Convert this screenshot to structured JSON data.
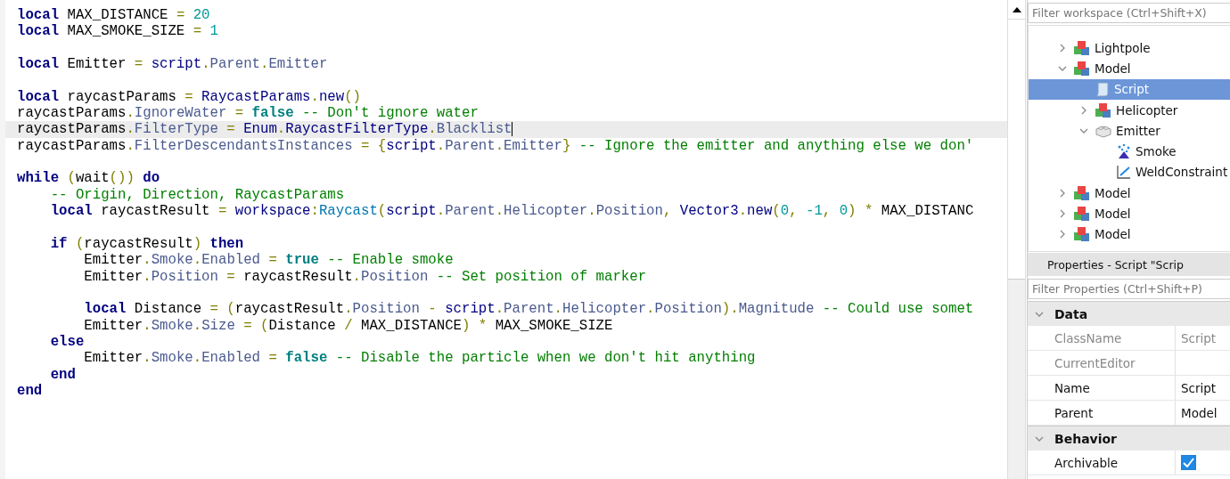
{
  "editor": {
    "lines": [
      {
        "kind": "code",
        "tokens": [
          {
            "kind": "kw",
            "text": "local"
          },
          {
            "kind": "p",
            "text": " MAX_DISTANCE"
          },
          {
            "kind": "op",
            "text": " ="
          },
          {
            "kind": "num",
            "text": " 20"
          }
        ]
      },
      {
        "kind": "code",
        "tokens": [
          {
            "kind": "kw",
            "text": "local"
          },
          {
            "kind": "p",
            "text": " MAX_SMOKE_SIZE"
          },
          {
            "kind": "op",
            "text": " ="
          },
          {
            "kind": "num",
            "text": " 1"
          }
        ]
      },
      {
        "kind": "blank"
      },
      {
        "kind": "code",
        "tokens": [
          {
            "kind": "kw",
            "text": "local"
          },
          {
            "kind": "p",
            "text": " Emitter"
          },
          {
            "kind": "op",
            "text": " ="
          },
          {
            "kind": "g",
            "text": " script"
          },
          {
            "kind": "op",
            "text": "."
          },
          {
            "kind": "pr",
            "text": "Parent"
          },
          {
            "kind": "op",
            "text": "."
          },
          {
            "kind": "pr",
            "text": "Emitter"
          }
        ]
      },
      {
        "kind": "blank"
      },
      {
        "kind": "code",
        "tokens": [
          {
            "kind": "kw",
            "text": "local"
          },
          {
            "kind": "p",
            "text": " raycastParams"
          },
          {
            "kind": "op",
            "text": " ="
          },
          {
            "kind": "g",
            "text": " RaycastParams"
          },
          {
            "kind": "op",
            "text": "."
          },
          {
            "kind": "g",
            "text": "new"
          },
          {
            "kind": "op",
            "text": "()"
          }
        ]
      },
      {
        "kind": "code",
        "tokens": [
          {
            "kind": "p",
            "text": "raycastParams"
          },
          {
            "kind": "op",
            "text": "."
          },
          {
            "kind": "pr",
            "text": "IgnoreWater"
          },
          {
            "kind": "op",
            "text": " ="
          },
          {
            "kind": "lit",
            "text": " false"
          },
          {
            "kind": "c",
            "text": " -- Don't ignore water"
          }
        ]
      },
      {
        "kind": "code",
        "current": true,
        "tokens": [
          {
            "kind": "p",
            "text": "raycastParams"
          },
          {
            "kind": "op",
            "text": "."
          },
          {
            "kind": "pr",
            "text": "FilterType"
          },
          {
            "kind": "op",
            "text": " ="
          },
          {
            "kind": "g",
            "text": " Enum"
          },
          {
            "kind": "op",
            "text": "."
          },
          {
            "kind": "g",
            "text": "RaycastFilterType"
          },
          {
            "kind": "op",
            "text": "."
          },
          {
            "kind": "pr",
            "text": "Blacklist"
          }
        ]
      },
      {
        "kind": "code",
        "tokens": [
          {
            "kind": "p",
            "text": "raycastParams"
          },
          {
            "kind": "op",
            "text": "."
          },
          {
            "kind": "pr",
            "text": "FilterDescendantsInstances"
          },
          {
            "kind": "op",
            "text": " = {"
          },
          {
            "kind": "g",
            "text": "script"
          },
          {
            "kind": "op",
            "text": "."
          },
          {
            "kind": "pr",
            "text": "Parent"
          },
          {
            "kind": "op",
            "text": "."
          },
          {
            "kind": "pr",
            "text": "Emitter"
          },
          {
            "kind": "op",
            "text": "}"
          },
          {
            "kind": "c",
            "text": " -- Ignore the emitter and anything else we don'"
          }
        ]
      },
      {
        "kind": "blank"
      },
      {
        "kind": "code",
        "tokens": [
          {
            "kind": "kw",
            "text": "while"
          },
          {
            "kind": "op",
            "text": " ("
          },
          {
            "kind": "p",
            "text": "wait"
          },
          {
            "kind": "op",
            "text": "())"
          },
          {
            "kind": "kw",
            "text": " do"
          }
        ]
      },
      {
        "kind": "code",
        "tokens": [
          {
            "kind": "c",
            "text": "    -- Origin, Direction, RaycastParams"
          }
        ]
      },
      {
        "kind": "code",
        "tokens": [
          {
            "kind": "kw",
            "text": "    local"
          },
          {
            "kind": "p",
            "text": " raycastResult"
          },
          {
            "kind": "op",
            "text": " ="
          },
          {
            "kind": "g",
            "text": " workspace"
          },
          {
            "kind": "op",
            "text": ":"
          },
          {
            "kind": "fn",
            "text": "Raycast"
          },
          {
            "kind": "op",
            "text": "("
          },
          {
            "kind": "g",
            "text": "script"
          },
          {
            "kind": "op",
            "text": "."
          },
          {
            "kind": "pr",
            "text": "Parent"
          },
          {
            "kind": "op",
            "text": "."
          },
          {
            "kind": "pr",
            "text": "Helicopter"
          },
          {
            "kind": "op",
            "text": "."
          },
          {
            "kind": "pr",
            "text": "Position"
          },
          {
            "kind": "op",
            "text": ","
          },
          {
            "kind": "g",
            "text": " Vector3"
          },
          {
            "kind": "op",
            "text": "."
          },
          {
            "kind": "g",
            "text": "new"
          },
          {
            "kind": "op",
            "text": "("
          },
          {
            "kind": "num",
            "text": "0"
          },
          {
            "kind": "op",
            "text": ","
          },
          {
            "kind": "num",
            "text": " -1"
          },
          {
            "kind": "op",
            "text": ","
          },
          {
            "kind": "num",
            "text": " 0"
          },
          {
            "kind": "op",
            "text": ") *"
          },
          {
            "kind": "p",
            "text": " MAX_DISTANC"
          }
        ]
      },
      {
        "kind": "blank"
      },
      {
        "kind": "code",
        "tokens": [
          {
            "kind": "kw",
            "text": "    if"
          },
          {
            "kind": "op",
            "text": " ("
          },
          {
            "kind": "p",
            "text": "raycastResult"
          },
          {
            "kind": "op",
            "text": ")"
          },
          {
            "kind": "kw",
            "text": " then"
          }
        ]
      },
      {
        "kind": "code",
        "tokens": [
          {
            "kind": "p",
            "text": "        Emitter"
          },
          {
            "kind": "op",
            "text": "."
          },
          {
            "kind": "pr",
            "text": "Smoke"
          },
          {
            "kind": "op",
            "text": "."
          },
          {
            "kind": "pr",
            "text": "Enabled"
          },
          {
            "kind": "op",
            "text": " ="
          },
          {
            "kind": "lit",
            "text": " true"
          },
          {
            "kind": "c",
            "text": " -- Enable smoke"
          }
        ]
      },
      {
        "kind": "code",
        "tokens": [
          {
            "kind": "p",
            "text": "        Emitter"
          },
          {
            "kind": "op",
            "text": "."
          },
          {
            "kind": "pr",
            "text": "Position"
          },
          {
            "kind": "op",
            "text": " ="
          },
          {
            "kind": "p",
            "text": " raycastResult"
          },
          {
            "kind": "op",
            "text": "."
          },
          {
            "kind": "pr",
            "text": "Position"
          },
          {
            "kind": "c",
            "text": " -- Set position of marker"
          }
        ]
      },
      {
        "kind": "blank"
      },
      {
        "kind": "code",
        "tokens": [
          {
            "kind": "kw",
            "text": "        local"
          },
          {
            "kind": "p",
            "text": " Distance"
          },
          {
            "kind": "op",
            "text": " = ("
          },
          {
            "kind": "p",
            "text": "raycastResult"
          },
          {
            "kind": "op",
            "text": "."
          },
          {
            "kind": "pr",
            "text": "Position"
          },
          {
            "kind": "op",
            "text": " -"
          },
          {
            "kind": "g",
            "text": " script"
          },
          {
            "kind": "op",
            "text": "."
          },
          {
            "kind": "pr",
            "text": "Parent"
          },
          {
            "kind": "op",
            "text": "."
          },
          {
            "kind": "pr",
            "text": "Helicopter"
          },
          {
            "kind": "op",
            "text": "."
          },
          {
            "kind": "pr",
            "text": "Position"
          },
          {
            "kind": "op",
            "text": ")."
          },
          {
            "kind": "pr",
            "text": "Magnitude"
          },
          {
            "kind": "c",
            "text": " -- Could use somet"
          }
        ]
      },
      {
        "kind": "code",
        "tokens": [
          {
            "kind": "p",
            "text": "        Emitter"
          },
          {
            "kind": "op",
            "text": "."
          },
          {
            "kind": "pr",
            "text": "Smoke"
          },
          {
            "kind": "op",
            "text": "."
          },
          {
            "kind": "pr",
            "text": "Size"
          },
          {
            "kind": "op",
            "text": " = ("
          },
          {
            "kind": "p",
            "text": "Distance"
          },
          {
            "kind": "op",
            "text": " /"
          },
          {
            "kind": "p",
            "text": " MAX_DISTANCE"
          },
          {
            "kind": "op",
            "text": ") *"
          },
          {
            "kind": "p",
            "text": " MAX_SMOKE_SIZE"
          }
        ]
      },
      {
        "kind": "code",
        "tokens": [
          {
            "kind": "kw",
            "text": "    else"
          }
        ]
      },
      {
        "kind": "code",
        "tokens": [
          {
            "kind": "p",
            "text": "        Emitter"
          },
          {
            "kind": "op",
            "text": "."
          },
          {
            "kind": "pr",
            "text": "Smoke"
          },
          {
            "kind": "op",
            "text": "."
          },
          {
            "kind": "pr",
            "text": "Enabled"
          },
          {
            "kind": "op",
            "text": " ="
          },
          {
            "kind": "lit",
            "text": " false"
          },
          {
            "kind": "c",
            "text": " -- Disable the particle when we don't hit anything"
          }
        ]
      },
      {
        "kind": "code",
        "tokens": [
          {
            "kind": "kw",
            "text": "    end"
          }
        ]
      },
      {
        "kind": "code",
        "tokens": [
          {
            "kind": "kw",
            "text": "end"
          }
        ]
      }
    ]
  },
  "explorer": {
    "filter": {
      "placeholder": "Filter workspace (Ctrl+Shift+X)"
    },
    "tree": [
      {
        "name": "Lightpole",
        "kind": "model",
        "expanded": false,
        "selected": false
      },
      {
        "name": "Model",
        "kind": "model",
        "expanded": true,
        "selected": false,
        "children": [
          {
            "name": "Script",
            "kind": "script",
            "selected": true
          },
          {
            "name": "Helicopter",
            "kind": "model",
            "expanded": false,
            "selected": false
          },
          {
            "name": "Emitter",
            "kind": "part",
            "expanded": true,
            "selected": false,
            "children": [
              {
                "name": "Smoke",
                "kind": "particles",
                "selected": false
              },
              {
                "name": "WeldConstraint",
                "kind": "weld",
                "selected": false
              }
            ]
          }
        ]
      },
      {
        "name": "Model",
        "kind": "model",
        "expanded": false,
        "selected": false
      },
      {
        "name": "Model",
        "kind": "model",
        "expanded": false,
        "selected": false
      },
      {
        "name": "Model",
        "kind": "model",
        "expanded": false,
        "selected": false
      }
    ]
  },
  "properties": {
    "title": "Properties - Script \"Scrip",
    "filter": {
      "placeholder": "Filter Properties (Ctrl+Shift+P)"
    },
    "groups": [
      {
        "name": "Data",
        "expanded": true,
        "rows": [
          {
            "name": "ClassName",
            "value": "Script",
            "readonly": true
          },
          {
            "name": "CurrentEditor",
            "readonly": true
          },
          {
            "name": "Name",
            "value": "Script",
            "readonly": false
          },
          {
            "name": "Parent",
            "value": "Model",
            "readonly": false
          }
        ]
      },
      {
        "name": "Behavior",
        "expanded": true,
        "rows": [
          {
            "name": "Archivable",
            "kind": "checkbox",
            "checked": true,
            "readonly": false
          }
        ]
      }
    ]
  }
}
